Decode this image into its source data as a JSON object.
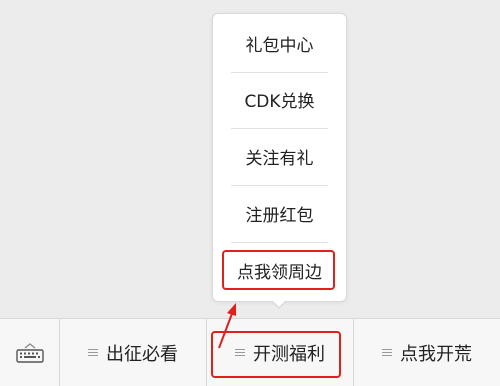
{
  "popup_menu": {
    "items": [
      {
        "label": "礼包中心"
      },
      {
        "label": "CDK兑换"
      },
      {
        "label": "关注有礼"
      },
      {
        "label": "注册红包"
      },
      {
        "label": "点我领周边"
      }
    ],
    "highlighted_item": "点我领周边"
  },
  "bottom_menu": {
    "keyboard_icon": "keyboard-icon",
    "tabs": [
      {
        "label": "出征必看",
        "icon": "menu-lines-icon"
      },
      {
        "label": "开测福利",
        "icon": "menu-lines-icon",
        "active": true
      },
      {
        "label": "点我开荒",
        "icon": "menu-lines-icon"
      }
    ]
  },
  "annotation": {
    "color": "#e0201d",
    "arrow_icon": "arrow-icon"
  }
}
